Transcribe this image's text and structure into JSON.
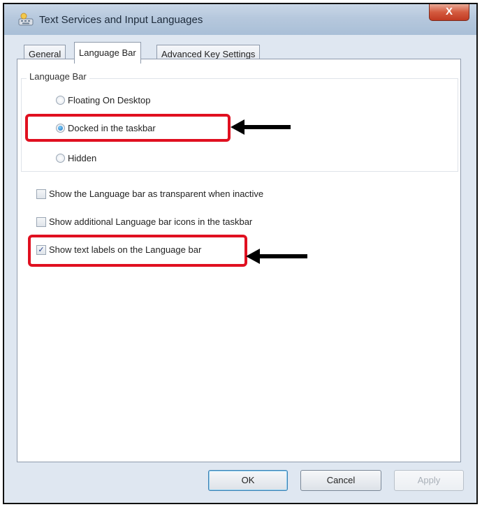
{
  "window": {
    "title": "Text Services and Input Languages",
    "close_label": "X"
  },
  "tabs": [
    {
      "label": "General",
      "active": false
    },
    {
      "label": "Language Bar",
      "active": true
    },
    {
      "label": "Advanced Key Settings",
      "active": false
    }
  ],
  "language_bar_group": {
    "label": "Language Bar",
    "options": [
      {
        "label": "Floating On Desktop",
        "selected": false
      },
      {
        "label": "Docked in the taskbar",
        "selected": true
      },
      {
        "label": "Hidden",
        "selected": false
      }
    ]
  },
  "checkboxes": [
    {
      "label": "Show the Language bar as transparent when inactive",
      "checked": false
    },
    {
      "label": "Show additional Language bar icons in the taskbar",
      "checked": false
    },
    {
      "label": "Show text labels on the Language bar",
      "checked": true
    }
  ],
  "buttons": {
    "ok": "OK",
    "cancel": "Cancel",
    "apply": "Apply"
  },
  "annotations": {
    "highlight_color": "#e01020",
    "arrow_color": "#000000"
  }
}
